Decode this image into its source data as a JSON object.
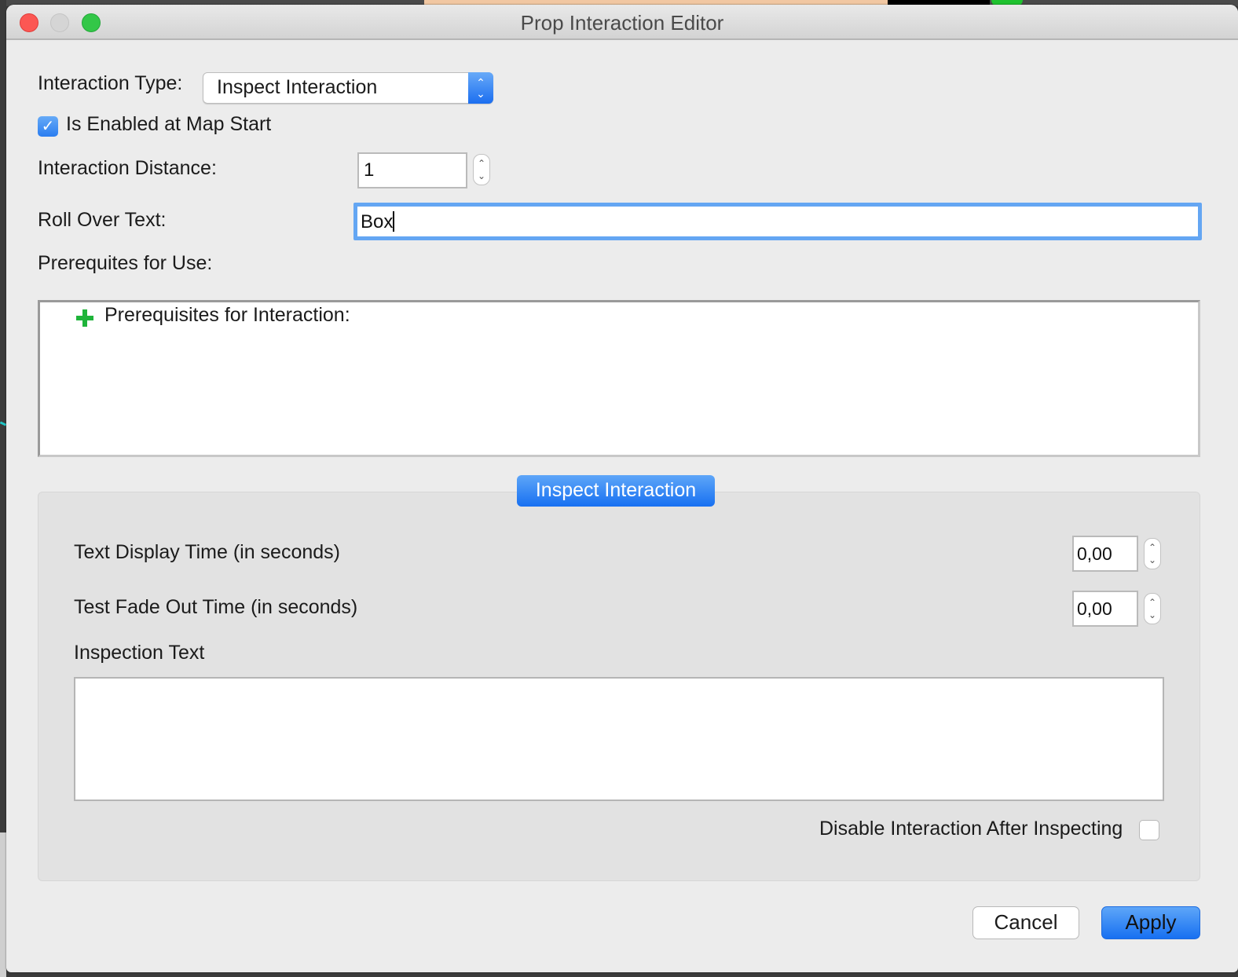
{
  "window": {
    "title": "Prop Interaction Editor"
  },
  "form": {
    "interaction_type_label": "Interaction Type:",
    "interaction_type_value": "Inspect Interaction",
    "enabled_at_start_label": "Is Enabled at Map Start",
    "enabled_at_start_checked": true,
    "interaction_distance_label": "Interaction Distance:",
    "interaction_distance_value": "1",
    "rollover_text_label": "Roll Over Text:",
    "rollover_text_value": "Box",
    "prerequisites_label": "Prerequites for Use:",
    "prerequisites_tree_root": "Prerequisites for Interaction:"
  },
  "inspect_group": {
    "title": "Inspect Interaction",
    "display_time_label": "Text Display Time (in seconds)",
    "display_time_value": "0,00",
    "fade_out_label": "Test Fade Out Time (in seconds)",
    "fade_out_value": "0,00",
    "inspection_text_label": "Inspection Text",
    "inspection_text_value": "",
    "disable_after_label": "Disable Interaction After Inspecting",
    "disable_after_checked": false
  },
  "buttons": {
    "cancel": "Cancel",
    "apply": "Apply"
  },
  "icons": {
    "checkmark": "✓",
    "up": "⌃",
    "down": "⌄"
  },
  "colors": {
    "accent": "#1b6ef0",
    "add_icon": "#1fb43a",
    "focus_ring": "#64a6f3"
  }
}
